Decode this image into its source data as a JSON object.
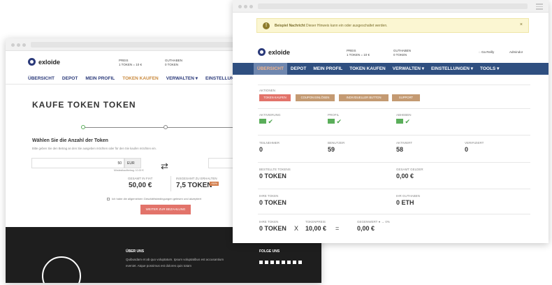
{
  "back": {
    "header": {
      "brand": "exloide",
      "price_label": "PREIS",
      "price_value": "1 TOKEN = 10 €",
      "balance_label": "GUTHABEN",
      "balance_value": "0 TOKEN"
    },
    "nav": [
      "ÜBERSICHT",
      "DEPOT",
      "MEIN PROFIL",
      "TOKEN KAUFEN",
      "VERWALTEN ▾",
      "EINSTELLUNGEN"
    ],
    "nav_active": 3,
    "title": "KAUFE TOKEN TOKEN",
    "amount_heading": "Wählen Sie die Anzahl der Token",
    "amount_hint": "Bitte geben Sie den Betrag an den Sie ausgeben möchten oder für den Sie kaufen möchten ein.",
    "amount_value": "50",
    "currency": "EUR",
    "min_note": "Mindestkaufbetrag: 10.00 €",
    "total_fiat_label": "GESAMT IN FIAT",
    "total_fiat": "50,00 €",
    "total_tokens_label": "INSGESAMT ZU ERHALTEN",
    "total_tokens": "7,5 TOKEN",
    "bonus_badge": "+50%",
    "agree_text": "Ich habe die allgemeinen Geschäftsbedingungen gelesen und akzeptiert",
    "continue_button": "WEITER ZUR BEZAHLUNG",
    "footer": {
      "about_title": "ÜBER UNS",
      "about_text": "Quibusdam et ab quo voluptatum. Ipsum voluptatibus est accusantium eveniet. Atque possimus est dolores quis totam",
      "follow_title": "FOLGE UNS"
    }
  },
  "front": {
    "alert": {
      "strong": "Beispiel Nachricht",
      "text": " Dieser Hinweis kann ein oder ausgeschaltet werden.",
      "close": "×"
    },
    "header": {
      "brand": "exloide",
      "price_label": "PREIS",
      "price_value": "1 TOKEN = 10 €",
      "balance_label": "GUTHABEN",
      "balance_value": "0 TOKEN",
      "user": "Ga Reilly",
      "admin": "Admindor"
    },
    "nav": [
      "ÜBERSICHT",
      "DEPOT",
      "MEIN PROFIL",
      "TOKEN KAUFEN",
      "VERWALTEN ▾",
      "EINSTELLUNGEN ▾",
      "TOOLS ▾"
    ],
    "nav_active": 0,
    "actions_label": "AKTIONEN",
    "actions": [
      "TOKEN KAUFEN",
      "COUPON EINLÖSEN",
      "INDIVIDUELLER BUTTON",
      "SUPPORT"
    ],
    "action_colors": [
      "#e2736a",
      "#c49a72",
      "#c49a72",
      "#c49a72"
    ],
    "status": [
      {
        "label": "AKTIVIERUNG",
        "icon": "mail-icon"
      },
      {
        "label": "PROFIL",
        "icon": "id-card-icon"
      },
      {
        "label": "ABHEBEN",
        "icon": "wallet-icon"
      }
    ],
    "stats": [
      {
        "label": "TEILNEHMER",
        "value": "0"
      },
      {
        "label": "BENUTZER",
        "value": "59"
      },
      {
        "label": "AKTIVIERT",
        "value": "58"
      },
      {
        "label": "VERIFIZIERT",
        "value": "0"
      }
    ],
    "ordered_label": "BESTELLTE TOKENS",
    "ordered_value": "0 TOKEN",
    "total_money_label": "GESAMT GELDER",
    "total_money_value": "0,00 €",
    "your_tokens_label": "IHRE TOKEN",
    "your_tokens_value": "0 TOKEN",
    "your_balance_label": "IHR GUTHABEN",
    "your_balance_value": "0 ETH",
    "calc": {
      "tokens_label": "IHRE TOKEN",
      "tokens_value": "0 TOKEN",
      "times": "X",
      "price_label": "TOKENPREIS",
      "price_value": "10,00 €",
      "equals": "=",
      "current_label": "GEGENWERT",
      "change": "0%",
      "current_value": "0,00 €"
    }
  }
}
